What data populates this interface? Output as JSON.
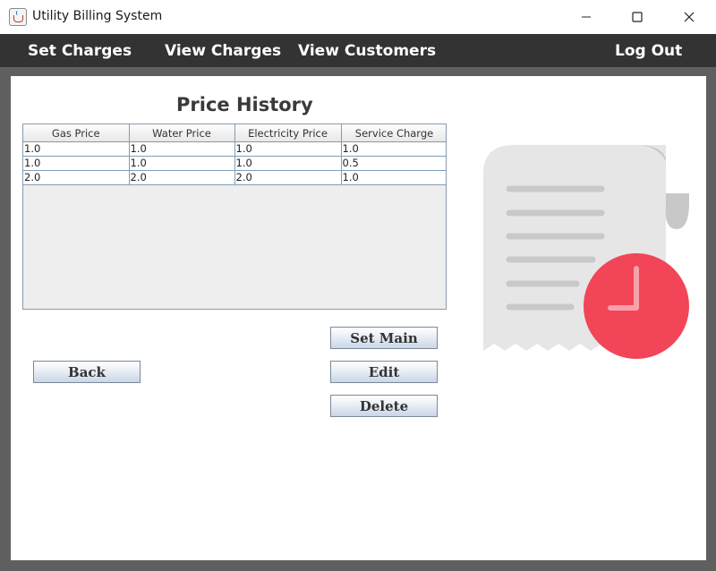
{
  "window": {
    "title": "Utility Billing System",
    "icon": "java-app-icon"
  },
  "menu": {
    "set_charges": "Set Charges",
    "view_charges": "View Charges",
    "view_customers": "View Customers",
    "log_out": "Log Out"
  },
  "page": {
    "title": "Price History"
  },
  "table": {
    "headers": [
      "Gas Price",
      "Water Price",
      "Electricity Price",
      "Service Charge"
    ],
    "rows": [
      [
        "1.0",
        "1.0",
        "1.0",
        "1.0"
      ],
      [
        "1.0",
        "1.0",
        "1.0",
        "0.5"
      ],
      [
        "2.0",
        "2.0",
        "2.0",
        "1.0"
      ]
    ]
  },
  "buttons": {
    "back": "Back",
    "set_main": "Set Main",
    "edit": "Edit",
    "delete": "Delete"
  },
  "illustration": {
    "name": "receipt-clock-icon",
    "colors": {
      "paper": "#e6e6e6",
      "paper_curl": "#c8c8c8",
      "lines": "#c9c9c9",
      "clock": "#f24557",
      "clock_hands": "#f7a1aa"
    }
  },
  "colors": {
    "menubar": "#333333",
    "frame": "#5f5f5f",
    "heading": "#3a3a3a"
  }
}
